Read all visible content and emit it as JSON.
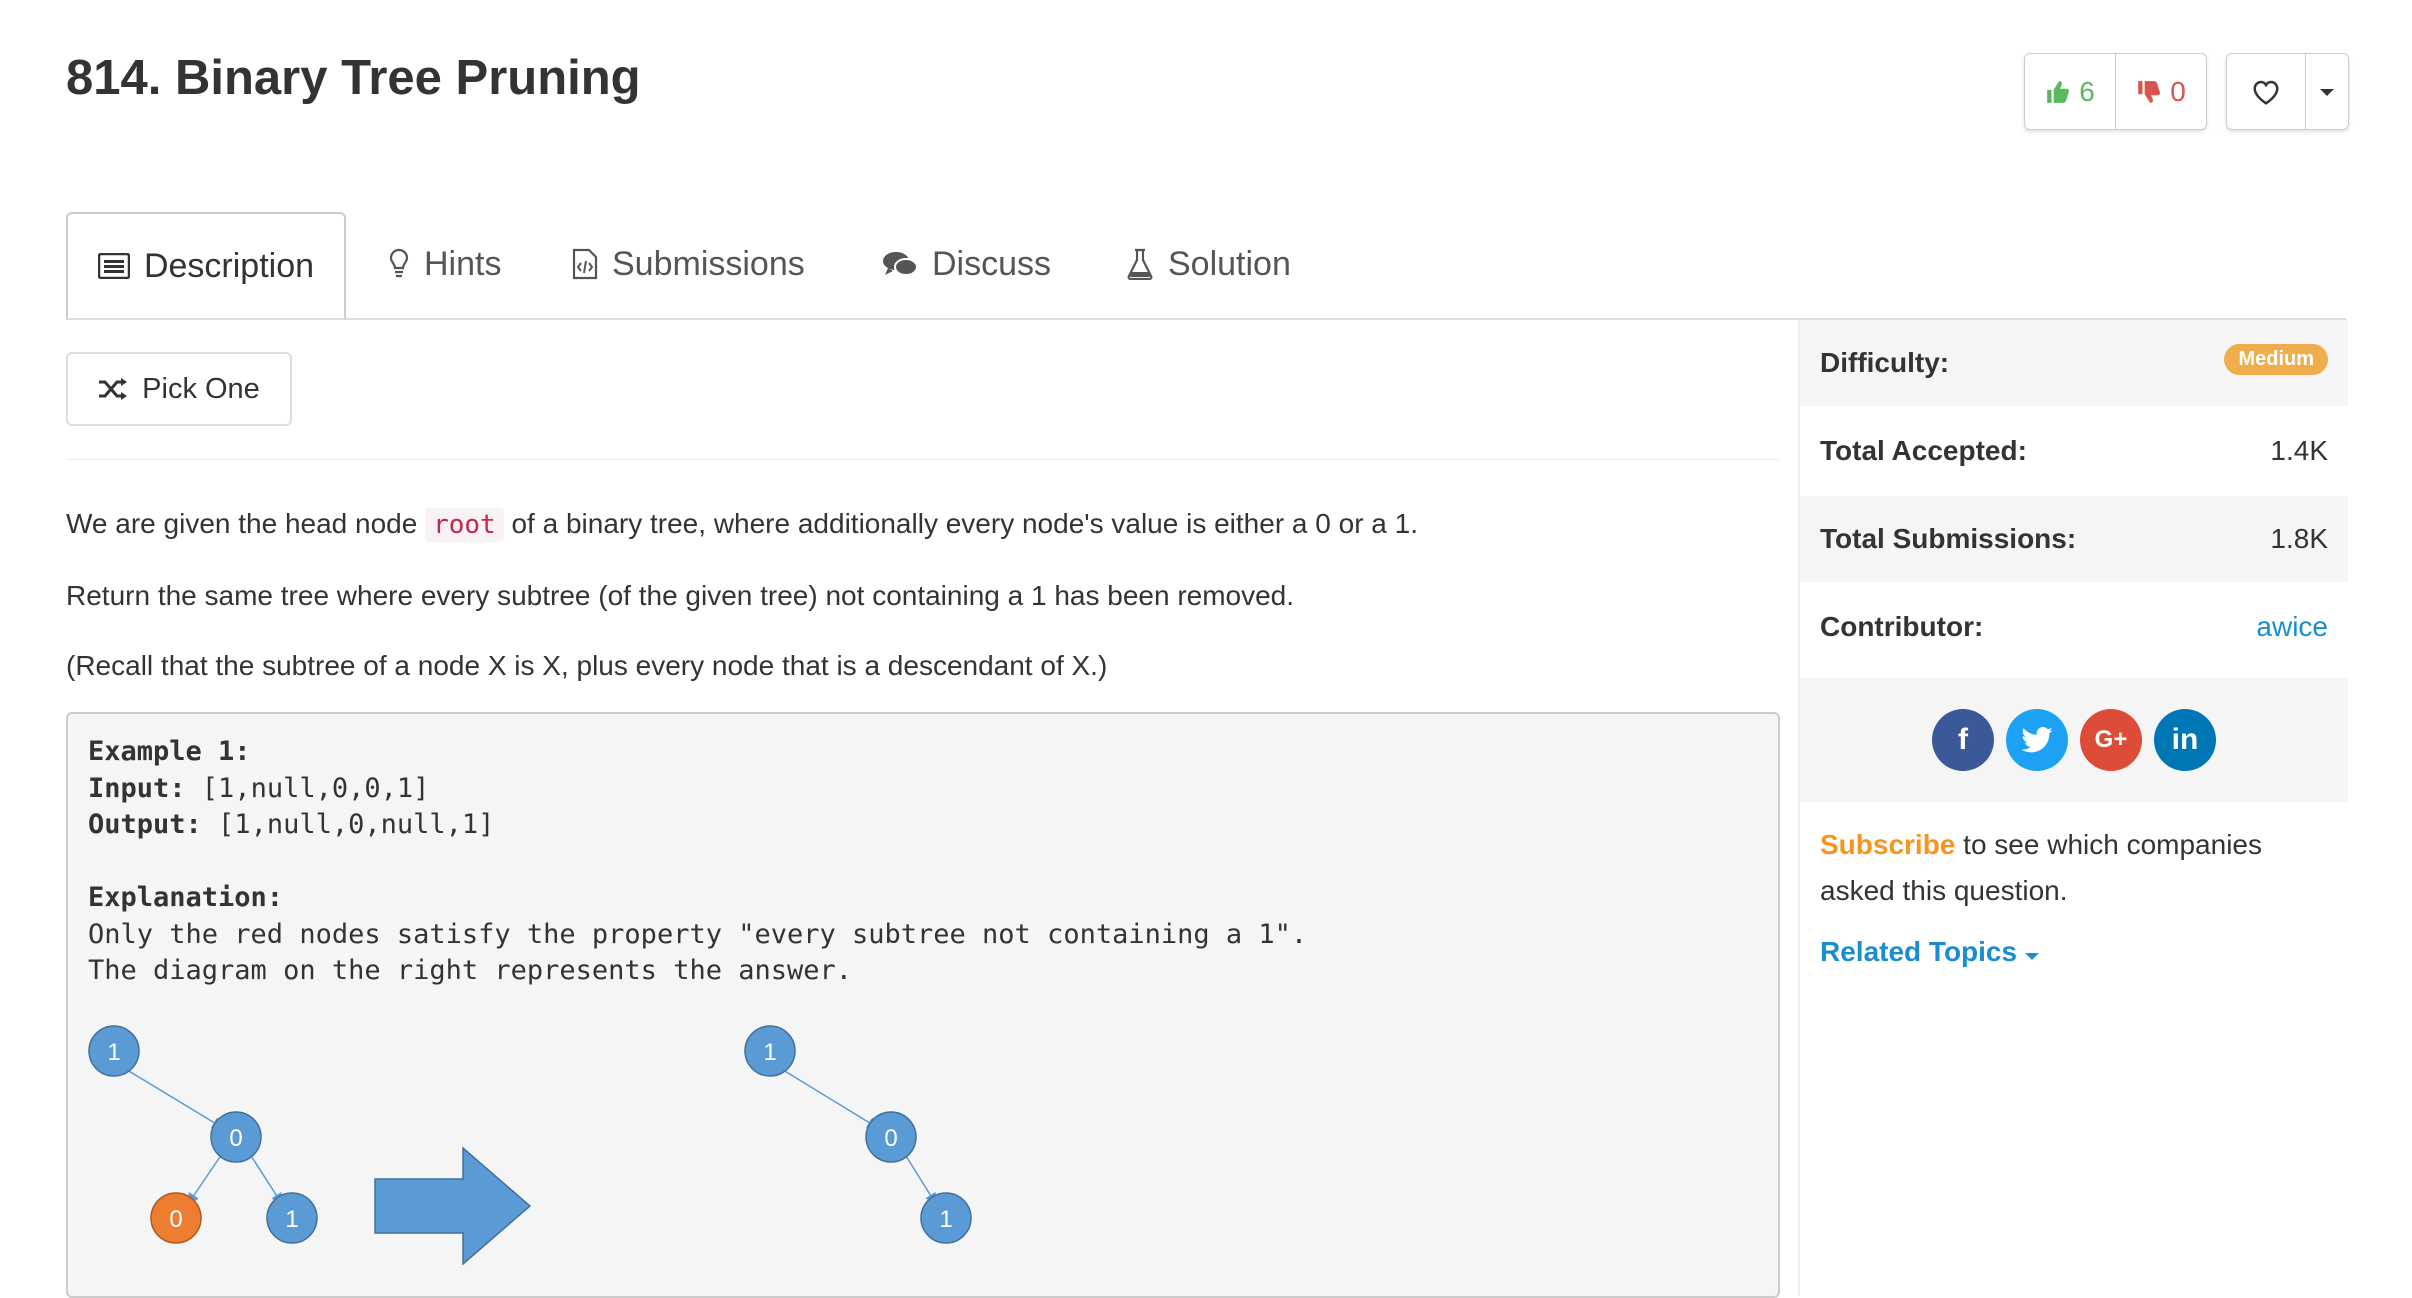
{
  "problem": {
    "title": "814. Binary Tree Pruning"
  },
  "votes": {
    "up": "6",
    "down": "0"
  },
  "tabs": [
    {
      "label": "Description"
    },
    {
      "label": "Hints"
    },
    {
      "label": "Submissions"
    },
    {
      "label": "Discuss"
    },
    {
      "label": "Solution"
    }
  ],
  "pick_one": "Pick One",
  "description": {
    "p1_before": "We are given the head node ",
    "p1_code": "root",
    "p1_after": " of a binary tree, where additionally every node's value is either a 0 or a 1.",
    "p2": "Return the same tree where every subtree (of the given tree) not containing a 1 has been removed.",
    "p3": "(Recall that the subtree of a node X is X, plus every node that is a descendant of X.)"
  },
  "example": {
    "heading": "Example 1:",
    "input_label": "Input:",
    "input_value": " [1,null,0,0,1]",
    "output_label": "Output:",
    "output_value": " [1,null,0,null,1]",
    "explanation_label": "Explanation:",
    "explanation_line1": "Only the red nodes satisfy the property \"every subtree not containing a 1\".",
    "explanation_line2": "The diagram on the right represents the answer.",
    "tree_before": [
      "1",
      "0",
      "0",
      "1"
    ],
    "tree_after": [
      "1",
      "0",
      "1"
    ]
  },
  "sidebar": {
    "difficulty_label": "Difficulty:",
    "difficulty_value": "Medium",
    "accepted_label": "Total Accepted:",
    "accepted_value": "1.4K",
    "submissions_label": "Total Submissions:",
    "submissions_value": "1.8K",
    "contributor_label": "Contributor:",
    "contributor_value": "awice",
    "social": [
      "f",
      "t",
      "G+",
      "in"
    ],
    "subscribe_link": "Subscribe",
    "subscribe_text": " to see which companies asked this question.",
    "related_topics": "Related Topics"
  },
  "colors": {
    "node_blue": "#5b9bd5",
    "node_orange": "#ed7d31",
    "accent_blue": "#1a8dd1",
    "medium_badge": "#f0ad4e",
    "subscribe_orange": "#f7941d"
  }
}
